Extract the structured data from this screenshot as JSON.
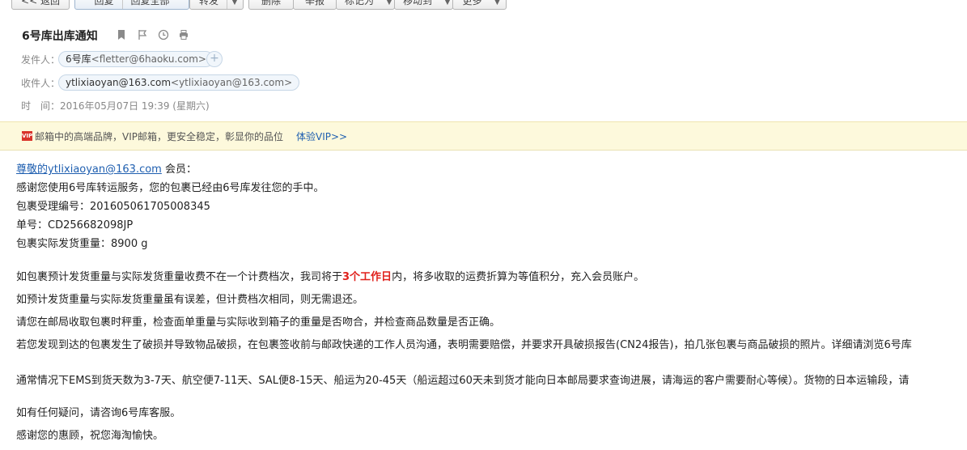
{
  "toolbar": {
    "back": "<< 返回",
    "reply": "回复",
    "reply_all": "回复全部",
    "forward": "转发",
    "delete": "删除",
    "report": "举报",
    "mark_as": "标记为",
    "move_to": "移动到",
    "more": "更多"
  },
  "mail": {
    "subject": "6号库出库通知",
    "sender_label": "发件人：",
    "sender_name": "6号库",
    "sender_addr": "<fletter@6haoku.com>",
    "recipient_label": "收件人：",
    "recipient_name": "ytlixiaoyan@163.com",
    "recipient_addr": "<ytlixiaoyan@163.com>",
    "time_label": "时　间：",
    "time_value": "2016年05月07日 19:39 (星期六)"
  },
  "vip": {
    "badge": "VIP",
    "text": "邮箱中的高端品牌，VIP邮箱，更安全稳定，彰显你的品位",
    "link": "体验VIP>>"
  },
  "body": {
    "greeting_link": "尊敬的ytlixiaoyan@163.com",
    "greeting_suffix": " 会员：",
    "line1": "感谢您使用6号库转运服务，您的包裹已经由6号库发往您的手中。",
    "line2": "包裹受理编号：201605061705008345",
    "line3": "单号：CD256682098JP",
    "line4": "包裹实际发货重量：8900 g",
    "p1_before": "如包裹预计发货重量与实际发货重量收费不在一个计费档次，我司将于",
    "p1_highlight": "3个工作日",
    "p1_after": "内，将多收取的运费折算为等值积分，充入会员账户。",
    "p2": "如预计发货重量与实际发货重量虽有误差，但计费档次相同，则无需退还。",
    "p3": "请您在邮局收取包裹时秤重，检查面单重量与实际收到箱子的重量是否吻合，并检查商品数量是否正确。",
    "p4": "若您发现到达的包裹发生了破损并导致物品破损，在包裹签收前与邮政快递的工作人员沟通，表明需要赔偿，并要求开具破损报告(CN24报告)，拍几张包裹与商品破损的照片。详细请浏览6号库",
    "p5": "通常情况下EMS到货天数为3-7天、航空便7-11天、SAL便8-15天、船运为20-45天（船运超过60天未到货才能向日本邮局要求查询进展，请海运的客户需要耐心等候）。货物的日本运输段，请",
    "p6": "如有任何疑问，请咨询6号库客服。",
    "p7": "感谢您的惠顾，祝您海淘愉快。"
  }
}
